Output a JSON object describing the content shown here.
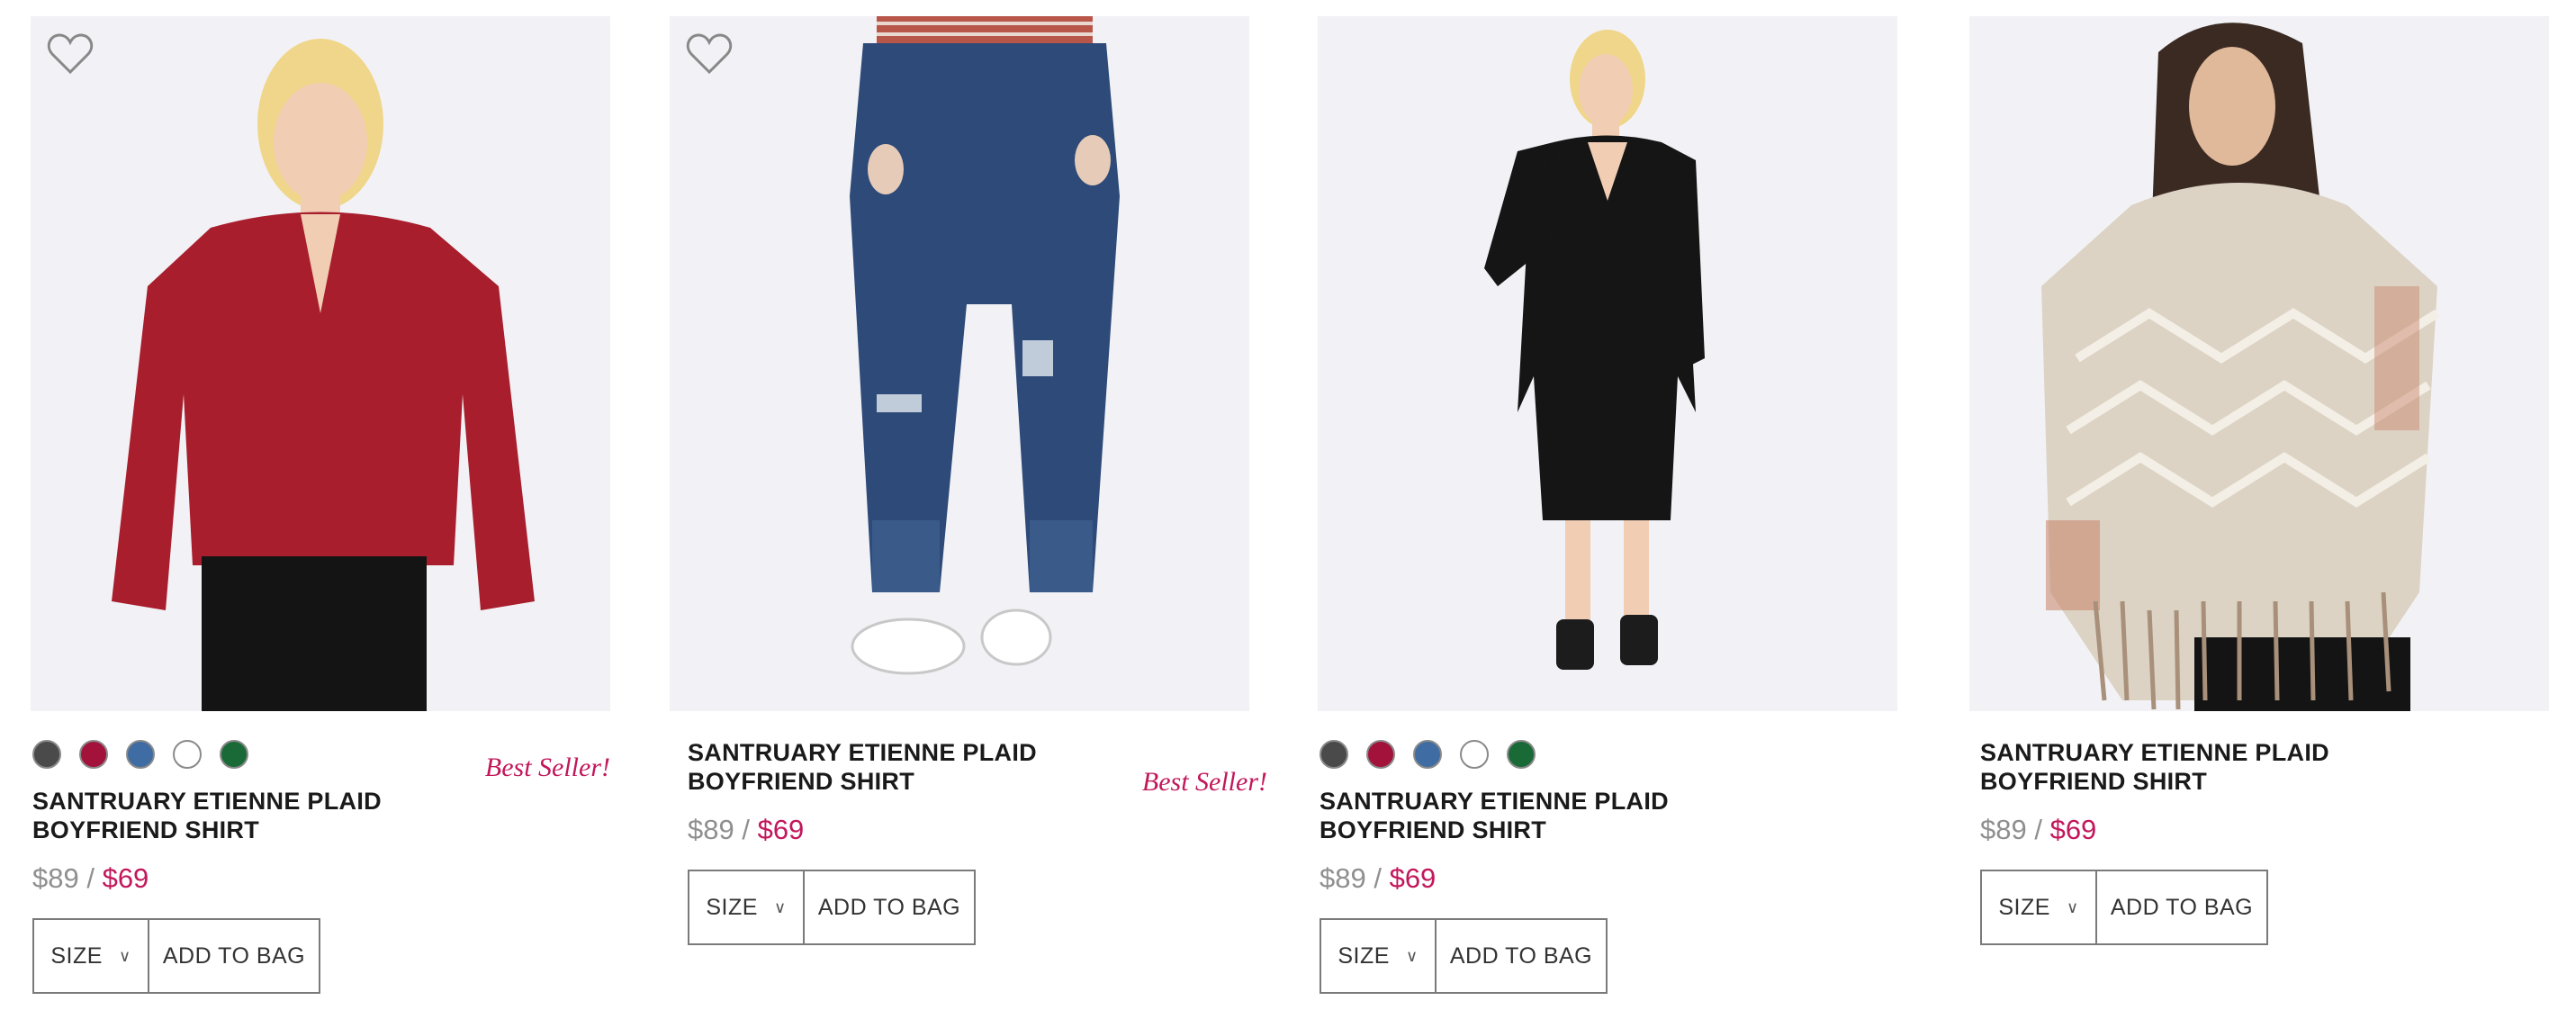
{
  "products": [
    {
      "name_line1": "SANTRUARY ETIENNE PLAID",
      "name_line2": "BOYFRIEND SHIRT",
      "price_original": "$89",
      "price_separator": " / ",
      "price_sale": "$69",
      "badge": "Best Seller!",
      "size_label": "SIZE",
      "add_label": "ADD TO BAG",
      "favorite": true,
      "swatches": [
        "#4a4a4a",
        "#a3123a",
        "#3f6da3",
        "#ffffff",
        "#1a6a38"
      ]
    },
    {
      "name_line1": "SANTRUARY ETIENNE PLAID",
      "name_line2": "BOYFRIEND SHIRT",
      "price_original": "$89",
      "price_separator": " / ",
      "price_sale": "$69",
      "badge": "Best Seller!",
      "size_label": "SIZE",
      "add_label": "ADD TO BAG",
      "favorite": true,
      "swatches": []
    },
    {
      "name_line1": "SANTRUARY ETIENNE PLAID",
      "name_line2": "BOYFRIEND SHIRT",
      "price_original": "$89",
      "price_separator": " / ",
      "price_sale": "$69",
      "badge": "",
      "size_label": "SIZE",
      "add_label": "ADD TO BAG",
      "favorite": false,
      "swatches": [
        "#4a4a4a",
        "#a3123a",
        "#3f6da3",
        "#ffffff",
        "#1a6a38"
      ]
    },
    {
      "name_line1": "SANTRUARY ETIENNE PLAID",
      "name_line2": "BOYFRIEND SHIRT",
      "price_original": "$89",
      "price_separator": " / ",
      "price_sale": "$69",
      "badge": "",
      "size_label": "SIZE",
      "add_label": "ADD TO BAG",
      "favorite": false,
      "swatches": []
    }
  ],
  "icons": {
    "favorite": "heart-outline-icon",
    "size_dropdown": "chevron-down-icon"
  },
  "colors": {
    "sale": "#c2185b",
    "original_price": "#8f8f8f",
    "badge": "#c2185b"
  }
}
